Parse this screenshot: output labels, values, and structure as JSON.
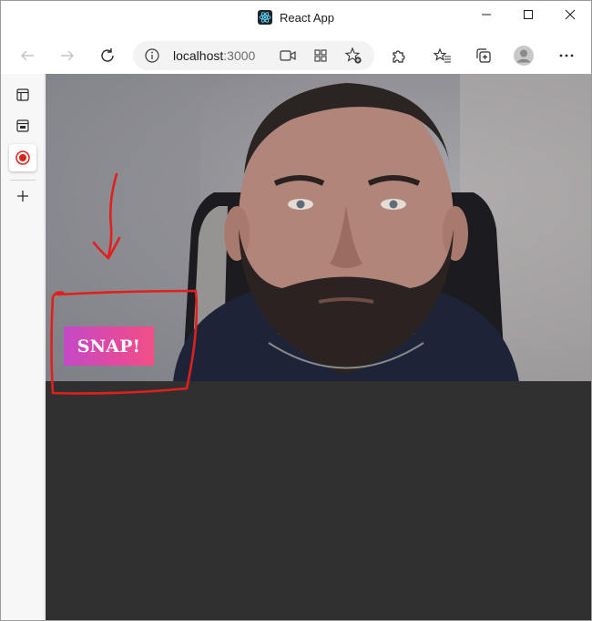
{
  "window": {
    "title": "React App"
  },
  "toolbar": {
    "url_host": "localhost",
    "url_port": ":3000"
  },
  "app": {
    "snap_label": "SNAP!"
  },
  "colors": {
    "content_bg": "#303030",
    "annotation": "#e0201c",
    "snap_gradient_start": "#c449c6",
    "snap_gradient_end": "#f14f86",
    "recording": "#d9261c"
  },
  "icons": [
    "react-logo-icon",
    "minimize-icon",
    "maximize-icon",
    "close-icon",
    "back-icon",
    "forward-icon",
    "refresh-icon",
    "info-icon",
    "camera-icon",
    "apps-icon",
    "add-favorite-icon",
    "extensions-icon",
    "favorites-icon",
    "collections-icon",
    "profile-icon",
    "more-icon",
    "tabs-icon",
    "history-icon",
    "record-icon",
    "add-icon"
  ]
}
